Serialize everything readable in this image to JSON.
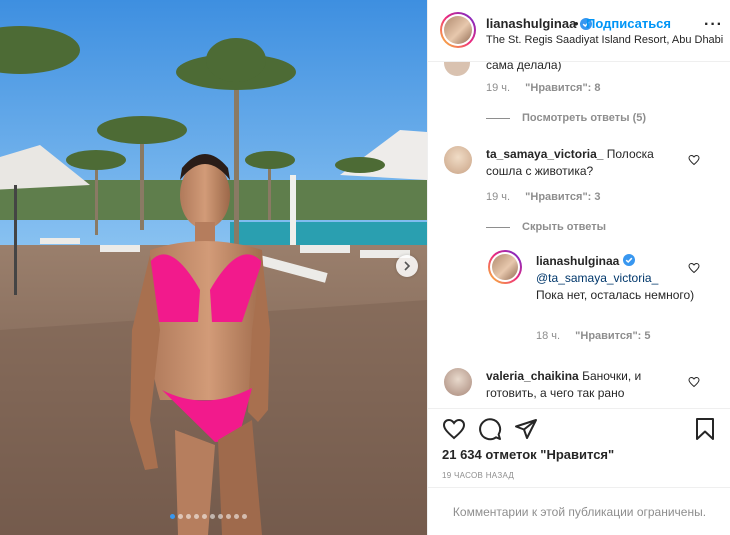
{
  "post": {
    "author": "lianashulginaa",
    "separator": "•",
    "follow_label": "Подписаться",
    "location": "The St. Regis Saadiyat Island Resort, Abu Dhabi",
    "more_label": "···"
  },
  "carousel": {
    "slides": 10,
    "active_slide": 1
  },
  "comments": {
    "partial": {
      "text": "сама делала)",
      "time": "19 ч.",
      "likes": "\"Нравится\": 8",
      "view_replies": "Посмотреть ответы (5)"
    },
    "second": {
      "username": "ta_samaya_victoria_",
      "text": "Полоска сошла с животика?",
      "time": "19 ч.",
      "likes": "\"Нравится\": 3",
      "hide_replies": "Скрыть ответы"
    },
    "reply": {
      "username": "lianashulginaa",
      "mention": "@ta_samaya_victoria_",
      "text": "Пока нет, осталась немного)",
      "time": "18 ч.",
      "likes": "\"Нравится\": 5"
    },
    "third": {
      "username": "valeria_chaikina",
      "text": "Баночки, и готовить, а чего так рано"
    }
  },
  "actions": {
    "likes_count": "21 634 отметок \"Нравится\"",
    "time_ago": "19 ЧАСОВ НАЗАД"
  },
  "footer": {
    "restricted": "Комментарии к этой публикации ограничены."
  },
  "colors": {
    "accent": "#0095f6",
    "text": "#262626",
    "muted": "#8e8e8e",
    "border": "#efefef"
  }
}
